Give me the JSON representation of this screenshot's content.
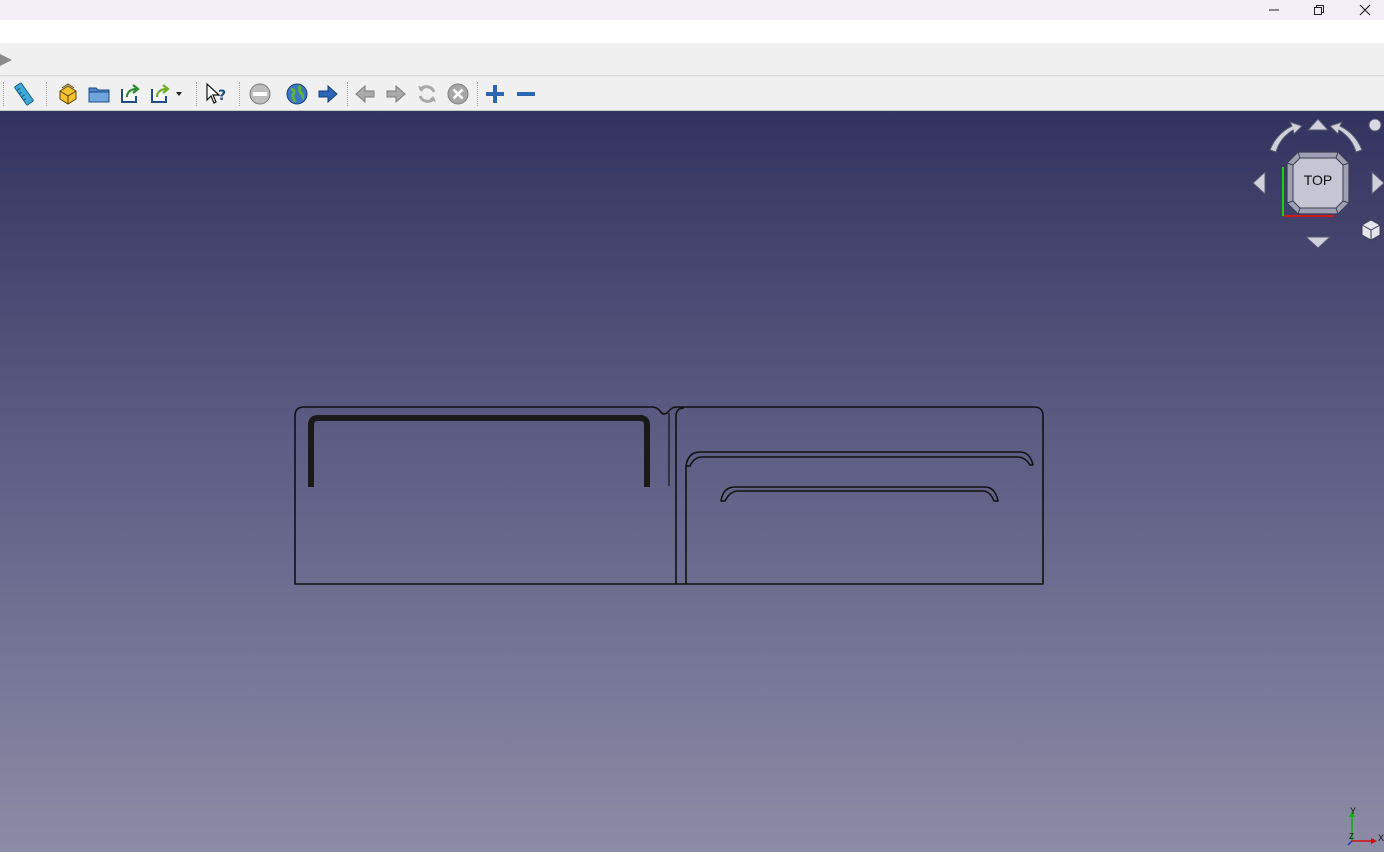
{
  "window": {
    "controls": [
      "minimize-icon",
      "restore-icon",
      "close-icon"
    ]
  },
  "toolbar": {
    "icons": [
      "measure-icon",
      "part-icon",
      "open-folder-icon",
      "export-icon",
      "export-dropdown-icon",
      "whats-this-icon",
      "stop-icon",
      "web-icon",
      "go-forward-icon",
      "back-icon",
      "forward-icon",
      "refresh-icon",
      "cancel-icon",
      "zoom-in-icon",
      "zoom-out-icon"
    ]
  },
  "navcube": {
    "face_label": "TOP"
  },
  "axes": {
    "x_label": "X",
    "y_label": "Y",
    "z_label": "Z",
    "x_color": "#d01010",
    "y_color": "#10b010",
    "z_color": "#2030d0"
  },
  "colors": {
    "viewport_top": "#33335f",
    "viewport_bottom": "#8c8ca6",
    "sketch_line": "#111111"
  }
}
